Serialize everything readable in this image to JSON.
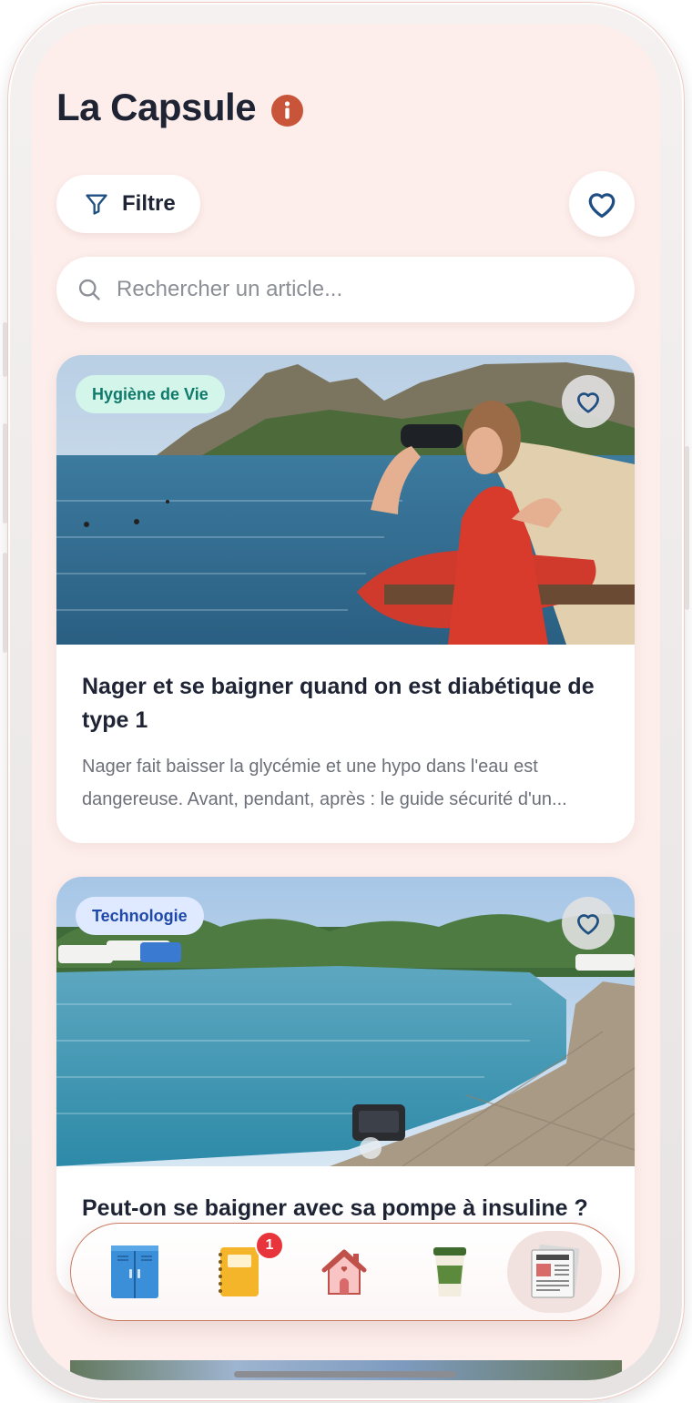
{
  "header": {
    "title": "La Capsule",
    "info_icon": "info-circle-icon"
  },
  "toolbar": {
    "filter_label": "Filtre",
    "filter_icon": "funnel-icon",
    "favorites_icon": "heart-outline-icon"
  },
  "search": {
    "placeholder": "Rechercher un article...",
    "icon": "search-icon"
  },
  "articles": [
    {
      "category": "Hygiène de Vie",
      "category_color": "#0f7a6a",
      "category_bg": "#d3f5ea",
      "title": "Nager et se baigner quand on est diabétique de type 1",
      "excerpt": "Nager fait baisser la glycémie et une hypo dans l'eau est dangereuse. Avant, pendant, après : le guide sécurité d'un...",
      "image": "photo lifeguard woman with binoculars at beach"
    },
    {
      "category": "Technologie",
      "category_color": "#1f49a8",
      "category_bg": "#dfe9ff",
      "title": "Peut-on se baigner avec sa pompe à insuline ?",
      "excerpt": "",
      "image": "photo swimming pool with insulin pump device"
    }
  ],
  "tabbar": {
    "items": [
      {
        "name": "locker",
        "icon": "locker-icon"
      },
      {
        "name": "notebook",
        "icon": "notebook-icon",
        "badge": "1"
      },
      {
        "name": "home",
        "icon": "house-icon"
      },
      {
        "name": "coffee",
        "icon": "coffee-cup-icon"
      },
      {
        "name": "news",
        "icon": "newspaper-icon",
        "active": true
      }
    ],
    "accent": "#c9785f"
  },
  "colors": {
    "background": "#fdeeeb",
    "text_primary": "#1e2434",
    "accent_info": "#c8553a",
    "heart_blue": "#1f4f82"
  }
}
